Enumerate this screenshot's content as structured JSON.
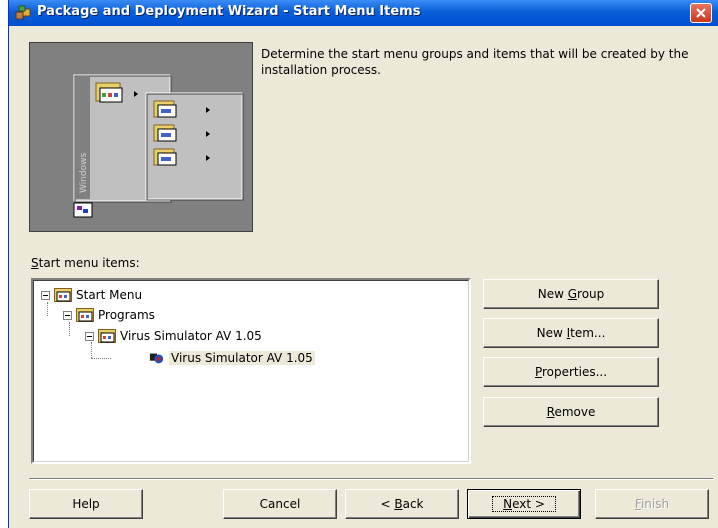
{
  "window": {
    "title": "Package and Deployment Wizard - Start Menu Items"
  },
  "banner": {
    "vertical_text": "Windows"
  },
  "description": "Determine the start menu groups and items that will be created by the installation process.",
  "tree": {
    "label_prefix": "S",
    "label_rest": "tart menu items:",
    "nodes": [
      {
        "label": "Start Menu",
        "level": 0
      },
      {
        "label": "Programs",
        "level": 1
      },
      {
        "label": "Virus Simulator AV 1.05",
        "level": 2
      },
      {
        "label": "Virus Simulator AV 1.05",
        "level": 3
      }
    ]
  },
  "side_buttons": {
    "new_group_pre": "New ",
    "new_group_key": "G",
    "new_group_post": "roup",
    "new_item_pre": "New ",
    "new_item_key": "I",
    "new_item_post": "tem...",
    "properties_key": "P",
    "properties_post": "roperties...",
    "remove_key": "R",
    "remove_post": "emove"
  },
  "footer_buttons": {
    "help": "Help",
    "cancel": "Cancel",
    "back_pre": "< ",
    "back_key": "B",
    "back_post": "ack",
    "next_key": "N",
    "next_post": "ext >",
    "finish_key": "F",
    "finish_post": "inish"
  },
  "colors": {
    "titlebar": "#0a5fd8",
    "dialog": "#ece9d8",
    "close": "#c9381d"
  }
}
